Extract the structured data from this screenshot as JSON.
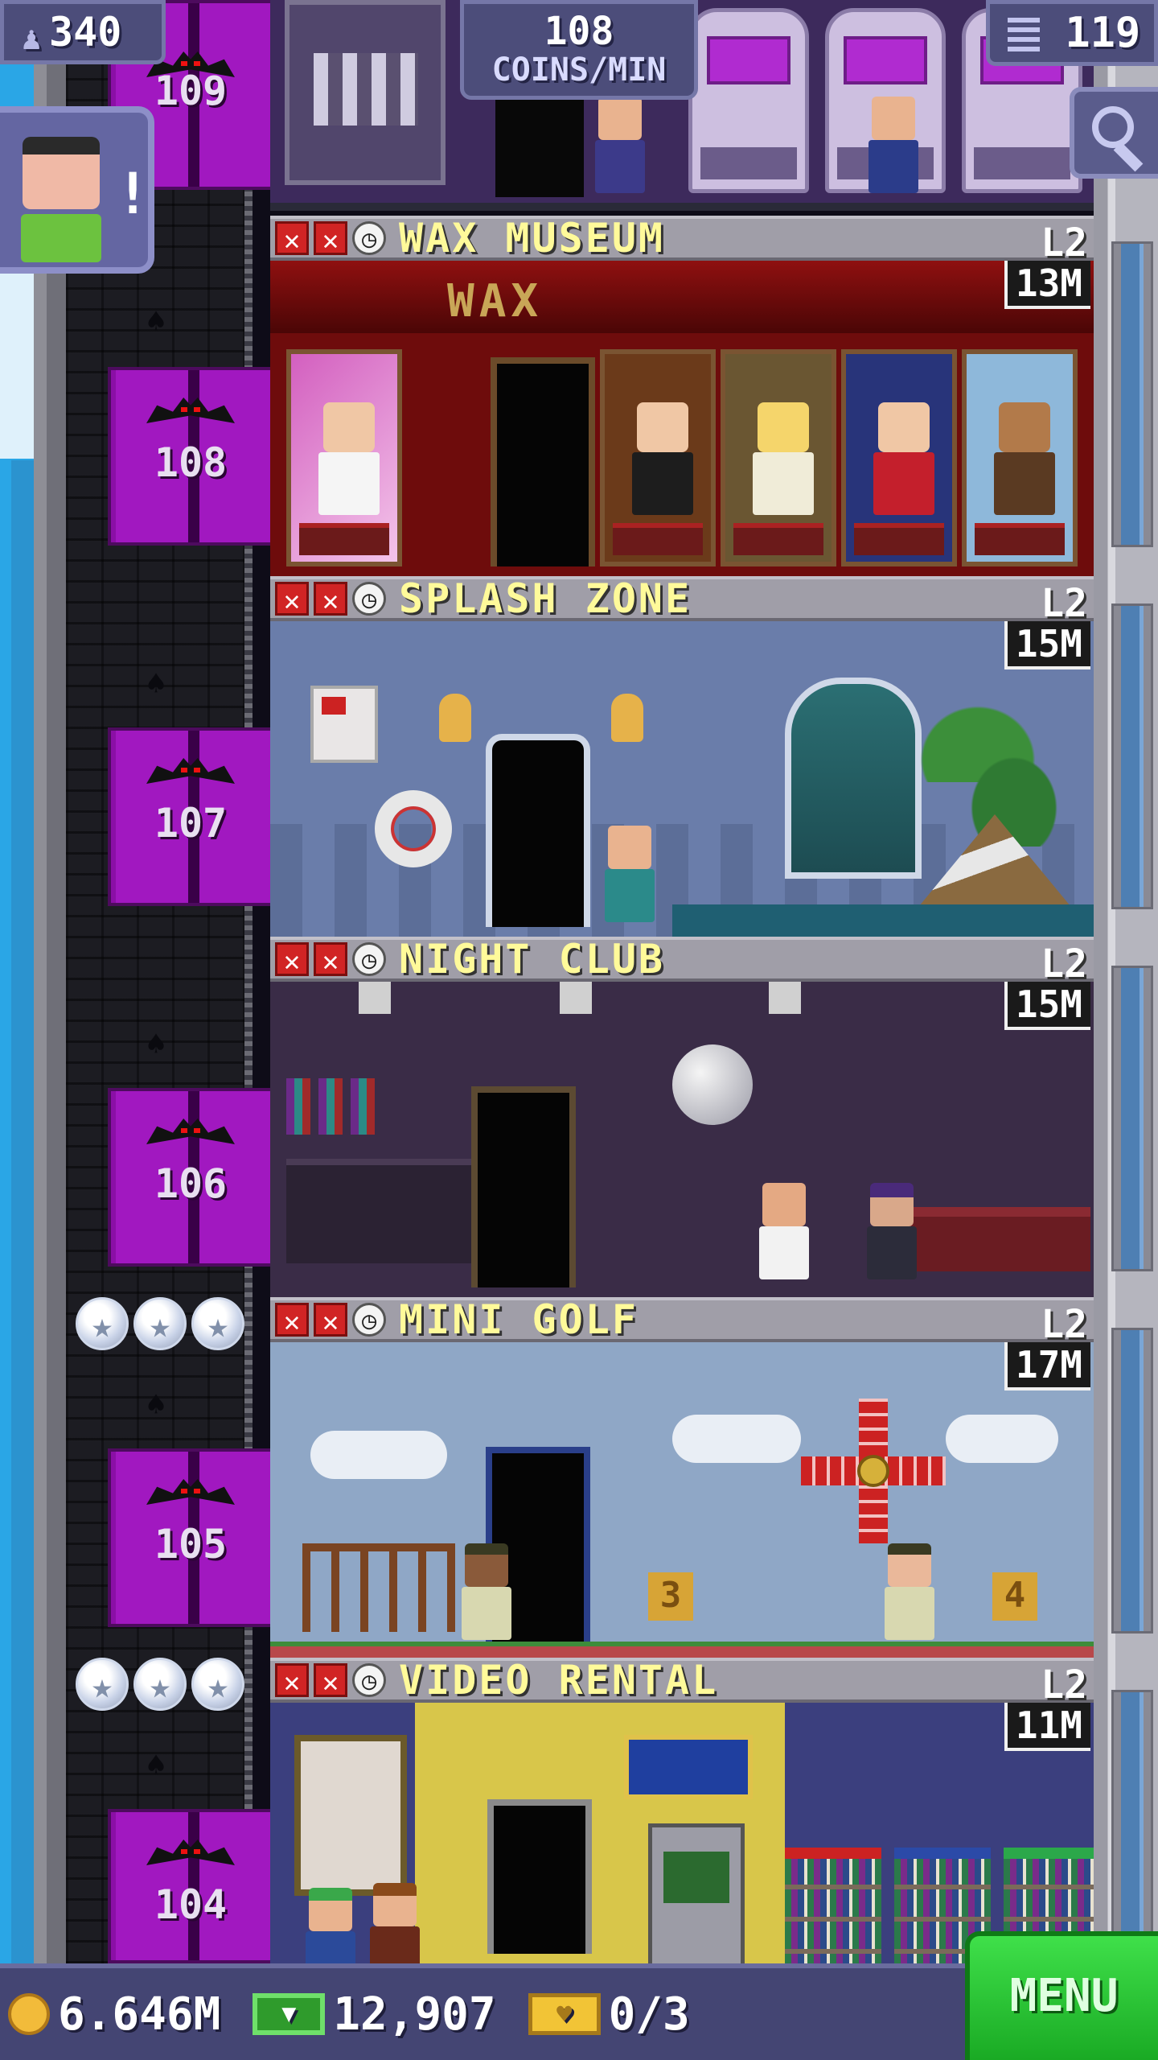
{
  "hud": {
    "population": "340",
    "coins_per_min_value": "108",
    "coins_per_min_label": "COINS/MIN",
    "floor_count": "119"
  },
  "elevator": {
    "floors": [
      "109",
      "108",
      "107",
      "106",
      "105",
      "104"
    ]
  },
  "floors": [
    {
      "name": "WAX MUSEUM",
      "level": "L2",
      "stock": "13M"
    },
    {
      "name": "SPLASH ZONE",
      "level": "L2",
      "stock": "15M"
    },
    {
      "name": "NIGHT CLUB",
      "level": "L2",
      "stock": "15M"
    },
    {
      "name": "MINI GOLF",
      "level": "L2",
      "stock": "17M"
    },
    {
      "name": "VIDEO RENTAL",
      "level": "L2",
      "stock": "11M"
    }
  ],
  "wax_museum": {
    "sign": "WAX"
  },
  "mini_golf": {
    "hole_a": "3",
    "hole_b": "4"
  },
  "bottom_bar": {
    "coins": "6.646M",
    "tower_bux": "12,907",
    "tickets": "0/3",
    "menu_label": "MENU"
  },
  "icons": {
    "missing_stock": "x-icon",
    "restock_timer": "clock-icon",
    "rating": "star-icon"
  },
  "colors": {
    "elevator": "#a118c0",
    "floor_title": "#fffa9a",
    "menu": "#2fd03a"
  }
}
